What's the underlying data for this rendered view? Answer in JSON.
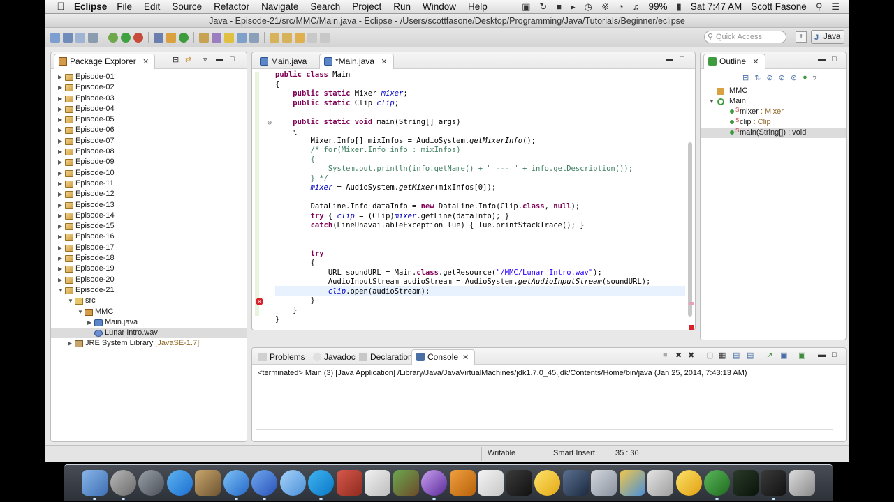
{
  "menubar": {
    "app_name": "Eclipse",
    "items": [
      "File",
      "Edit",
      "Source",
      "Refactor",
      "Navigate",
      "Search",
      "Project",
      "Run",
      "Window",
      "Help"
    ],
    "battery": "99%",
    "clock": "Sat 7:47 AM",
    "user": "Scott Fasone"
  },
  "window": {
    "title": "Java - Episode-21/src/MMC/Main.java - Eclipse - /Users/scottfasone/Desktop/Programming/Java/Tutorials/Beginner/eclipse"
  },
  "toolbar": {
    "quick_access_placeholder": "Quick Access",
    "perspective": "Java"
  },
  "package_explorer": {
    "title": "Package Explorer",
    "projects": [
      "Episode-01",
      "Episode-02",
      "Episode-03",
      "Episode-04",
      "Episode-05",
      "Episode-06",
      "Episode-07",
      "Episode-08",
      "Episode-09",
      "Episode-10",
      "Episode-11",
      "Episode-12",
      "Episode-13",
      "Episode-14",
      "Episode-15",
      "Episode-16",
      "Episode-17",
      "Episode-18",
      "Episode-19",
      "Episode-20",
      "Episode-21"
    ],
    "src": "src",
    "package": "MMC",
    "file_main": "Main.java",
    "file_wav": "Lunar Intro.wav",
    "jre_label": "JRE System Library",
    "jre_version": "[JavaSE-1.7]"
  },
  "editor": {
    "tabs": [
      "Main.java",
      "*Main.java"
    ],
    "active_tab": 1
  },
  "outline": {
    "title": "Outline",
    "package": "MMC",
    "class": "Main",
    "members": [
      {
        "name": "mixer",
        "type": " : Mixer"
      },
      {
        "name": "clip",
        "type": " : Clip"
      },
      {
        "name": "main(String[]) : void",
        "type": ""
      }
    ]
  },
  "console": {
    "tabs": [
      "Problems",
      "Javadoc",
      "Declaration",
      "Console"
    ],
    "active_tab": 3,
    "terminated_line": "<terminated> Main (3) [Java Application] /Library/Java/JavaVirtualMachines/jdk1.7.0_45.jdk/Contents/Home/bin/java (Jan 25, 2014, 7:43:13 AM)"
  },
  "status": {
    "writable": "Writable",
    "insert_mode": "Smart Insert",
    "position": "35 : 36"
  },
  "colors": {
    "keyword": "#7f0055",
    "field": "#0000c0",
    "string": "#2a00ff",
    "comment": "#3f7f5f",
    "error": "#d7222a"
  }
}
